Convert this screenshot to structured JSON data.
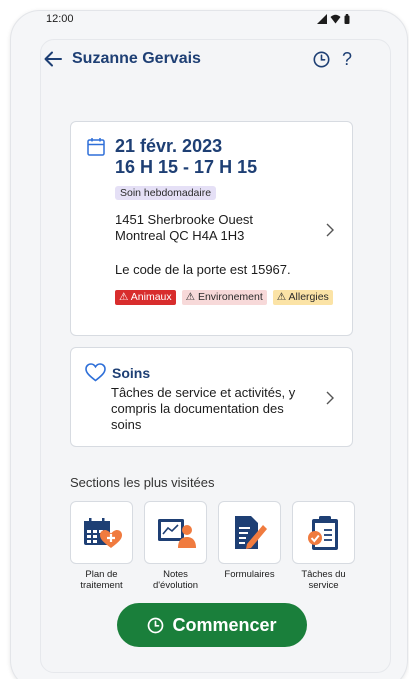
{
  "status": {
    "time": "12:00"
  },
  "header": {
    "title": "Suzanne Gervais",
    "help_label": "?"
  },
  "visit": {
    "date": "21 févr. 2023",
    "time_range": "16 H 15 - 17 H 15",
    "frequency_tag": "Soin hebdomadaire",
    "address_line1": "1451 Sherbrooke Ouest",
    "address_line2": "Montreal QC H4A 1H3",
    "door_code": "Le code de la porte est 15967.",
    "alerts": [
      {
        "label": "Animaux",
        "color": "#d82d2d"
      },
      {
        "label": "Environement",
        "color": "#f7d9d9"
      },
      {
        "label": "Allergies",
        "color": "#fbe3a6"
      }
    ]
  },
  "care": {
    "title": "Soins",
    "description": "Tâches de service et activités, y compris la documentation des soins"
  },
  "sections": {
    "label": "Sections les plus visitées",
    "items": [
      {
        "label": "Plan de traitement",
        "icon": "calendar-plus-icon"
      },
      {
        "label": "Notes d'évolution",
        "icon": "progress-notes-icon"
      },
      {
        "label": "Formulaires",
        "icon": "form-edit-icon"
      },
      {
        "label": "Tâches du service",
        "icon": "clipboard-check-icon"
      }
    ]
  },
  "action": {
    "start_label": "Commencer"
  },
  "colors": {
    "brand_blue": "#1e3f74",
    "accent_green": "#1a7f3b",
    "icon_orange": "#f07b3f"
  }
}
